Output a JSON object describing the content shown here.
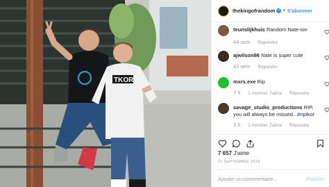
{
  "post": {
    "username": "thekingofrandom",
    "follow_label": "S'abonner",
    "separator": "•"
  },
  "comments": [
    {
      "username": "teunslijkhuis",
      "text": "Random Nate-ion",
      "time": "44 sem",
      "reply_label": "Répondre",
      "avatar_color": "#7a5a48"
    },
    {
      "username": "ajwilson86",
      "text": "Nate is super cute",
      "time": "42 sem",
      "reply_label": "Répondre",
      "avatar_color": "#3b2a20"
    },
    {
      "username": "mxrs.exe",
      "text": "Rip",
      "time": "7 h",
      "likes_label": "1 mention J'aime",
      "reply_label": "Répondre",
      "avatar_color": "#19c32b"
    },
    {
      "username": "savage_studio_productions",
      "text": "RIP, you will always be missed...",
      "hashtag": "#riptkor",
      "time": "3 h",
      "likes_label": "1 mention J'aime",
      "reply_label": "Répondre",
      "avatar_color": "#4a3a2e"
    }
  ],
  "actions": {
    "like_icon": "heart-icon",
    "comment_icon": "comment-icon",
    "share_icon": "share-icon",
    "save_icon": "bookmark-icon"
  },
  "likes": {
    "count": "7 657",
    "label": "J'aime"
  },
  "date": "21 SEPTEMBRE 2018",
  "add_comment": {
    "placeholder": "Ajouter un commentaire...",
    "publish_label": "Publier"
  },
  "colors": {
    "accent": "#3897f0",
    "text": "#262626",
    "muted": "#999999",
    "publish_disabled": "#b2dffc"
  }
}
